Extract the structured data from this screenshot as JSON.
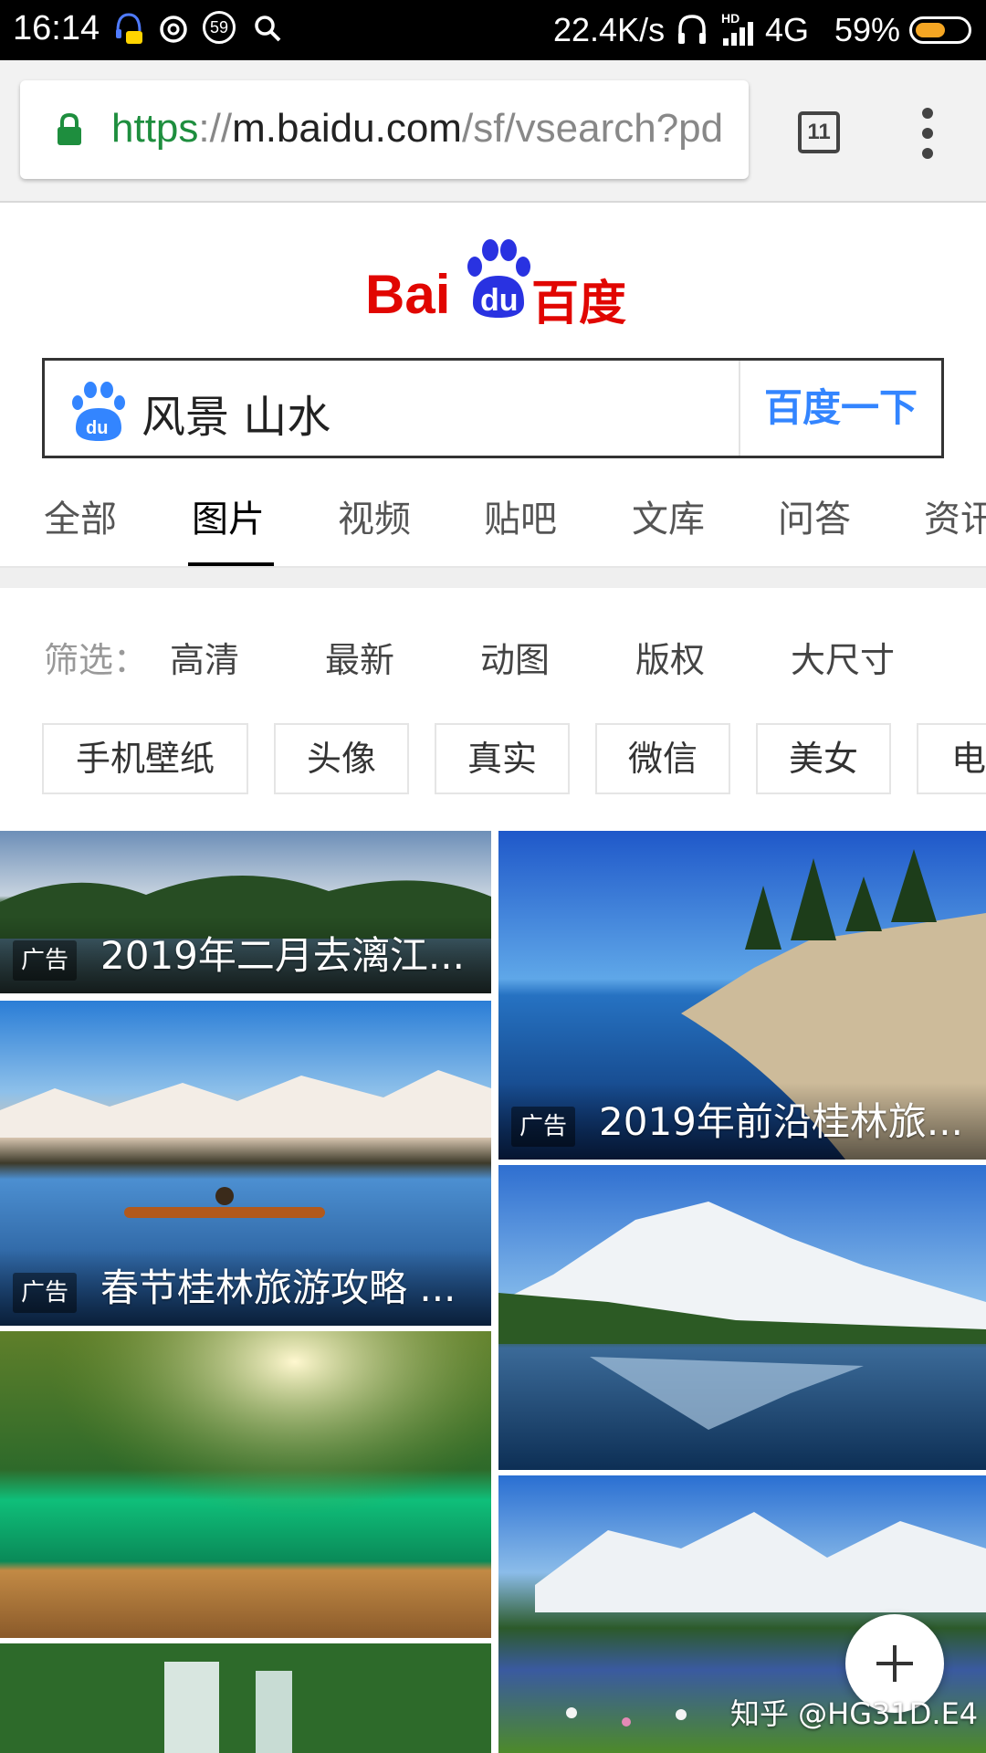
{
  "status_bar": {
    "time": "16:14",
    "notification_badge": "59",
    "net_speed": "22.4K/s",
    "hd_label": "HD",
    "network": "4G",
    "battery": "59%",
    "battery_level": 0.59,
    "icons": [
      "headset-chat-icon",
      "spiral-icon",
      "badge-59-icon",
      "search-icon",
      "headphones-icon",
      "signal-icon"
    ]
  },
  "browser": {
    "url_scheme": "https",
    "url_sep": "://",
    "url_host": "m.baidu.com",
    "url_path": "/sf/vsearch?pd",
    "tab_count": "11"
  },
  "logo": {
    "bai": "Bai",
    "du": "du",
    "chinese": "百度"
  },
  "search": {
    "query": "风景 山水",
    "button_label": "百度一下"
  },
  "tabs": [
    "全部",
    "图片",
    "视频",
    "贴吧",
    "文库",
    "问答",
    "资讯"
  ],
  "active_tab": "图片",
  "filter": {
    "label": "筛选：",
    "items": [
      "高清",
      "最新",
      "动图",
      "版权",
      "大尺寸"
    ]
  },
  "tags": [
    "手机壁纸",
    "头像",
    "真实",
    "微信",
    "美女",
    "电"
  ],
  "images": [
    {
      "ad_label": "广告",
      "caption": "2019年二月去漓江..."
    },
    {
      "ad_label": "广告",
      "caption": "2019年前沿桂林旅..."
    },
    {
      "ad_label": "广告",
      "caption": "春节桂林旅游攻略 ..."
    }
  ],
  "watermark": "知乎 @HG31D.E4",
  "colors": {
    "baidu_red": "#e10601",
    "baidu_blue": "#2932e1",
    "search_button": "#3385ff",
    "url_green": "#1e8e3e"
  }
}
